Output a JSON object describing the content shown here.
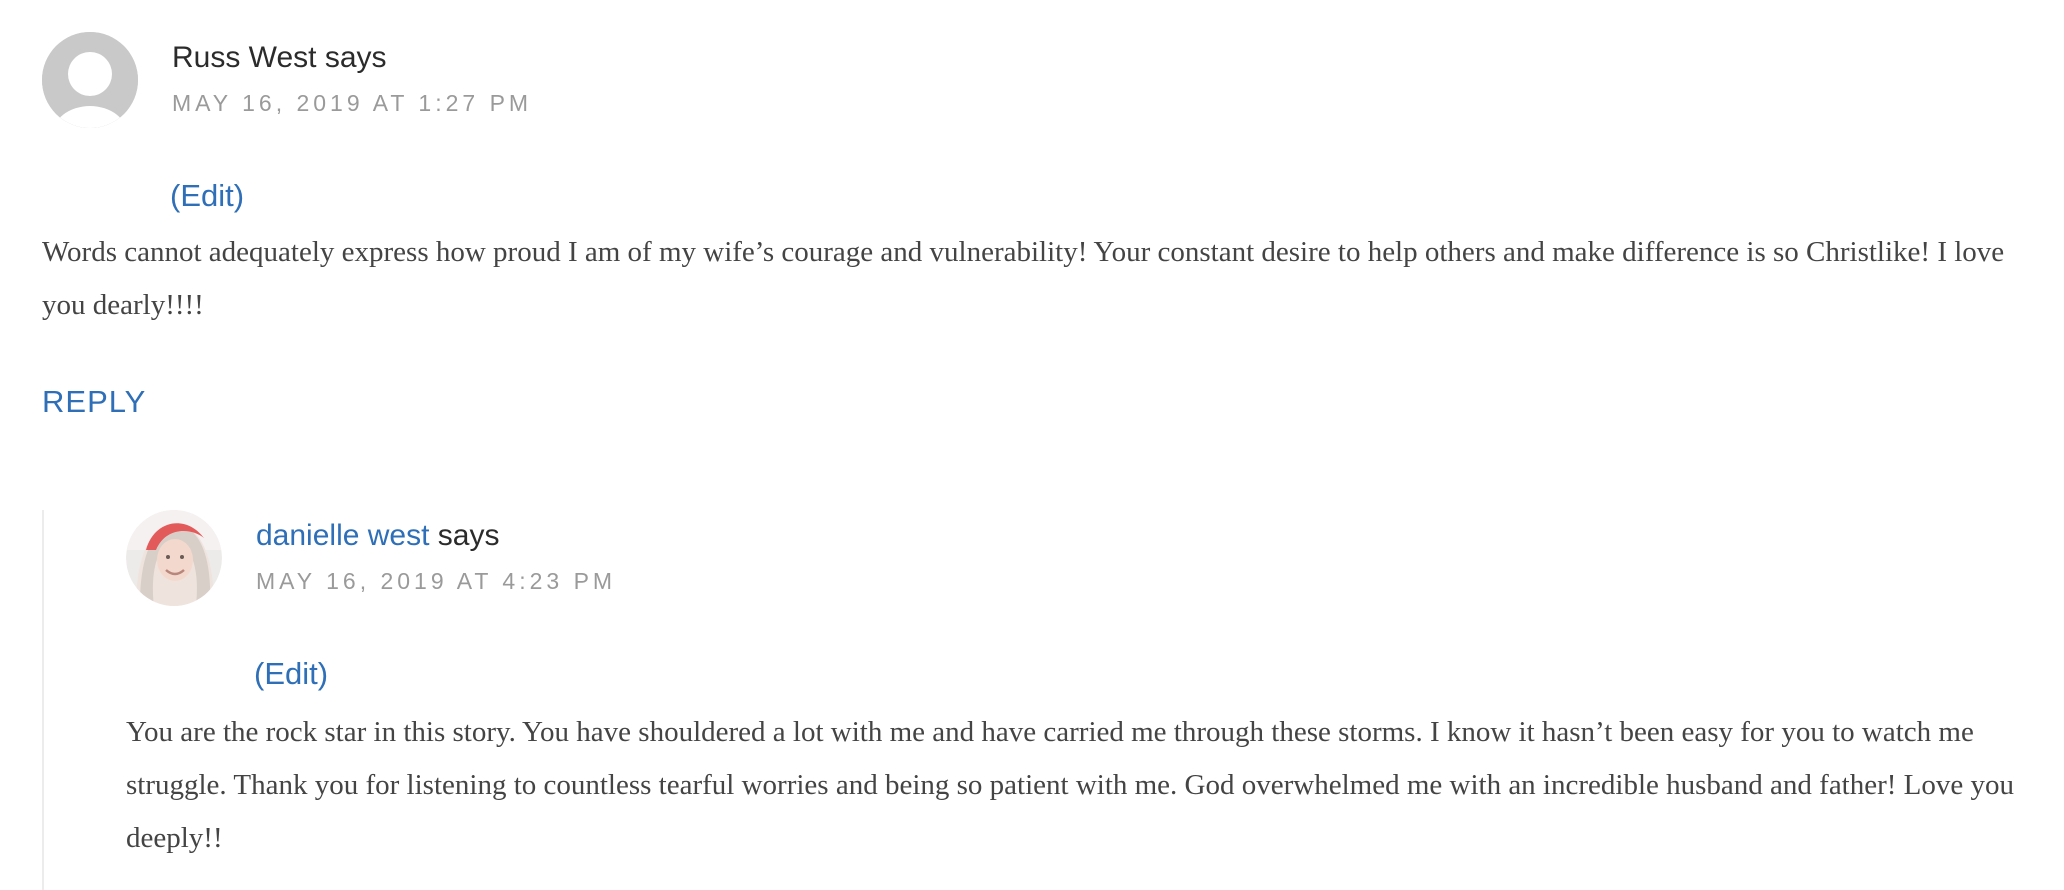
{
  "comments": [
    {
      "author": "Russ West",
      "author_link": false,
      "says": "says",
      "date": "MAY 16, 2019 AT 1:27 PM",
      "edit": "(Edit)",
      "text": "Words cannot adequately express how proud I am of my wife’s courage and vulnerability! Your constant desire to help others and make difference is so Christlike! I love you dearly!!!!",
      "reply": "REPLY",
      "avatar_icon": "default-avatar-icon"
    },
    {
      "author": "danielle west",
      "author_link": true,
      "says": "says",
      "date": "MAY 16, 2019 AT 4:23 PM",
      "edit": "(Edit)",
      "text": "You are the rock star in this story. You have shouldered a lot with me and have carried me through these storms. I know it hasn’t been easy for you to watch me struggle. Thank you for listening to countless tearful worries and being so patient with me. God overwhelmed me with an incredible husband and father! Love you deeply!!",
      "avatar_icon": "user-photo-avatar"
    }
  ],
  "colors": {
    "link": "#2e6fb7",
    "meta": "#9a9a9a",
    "body_text": "#444444"
  }
}
